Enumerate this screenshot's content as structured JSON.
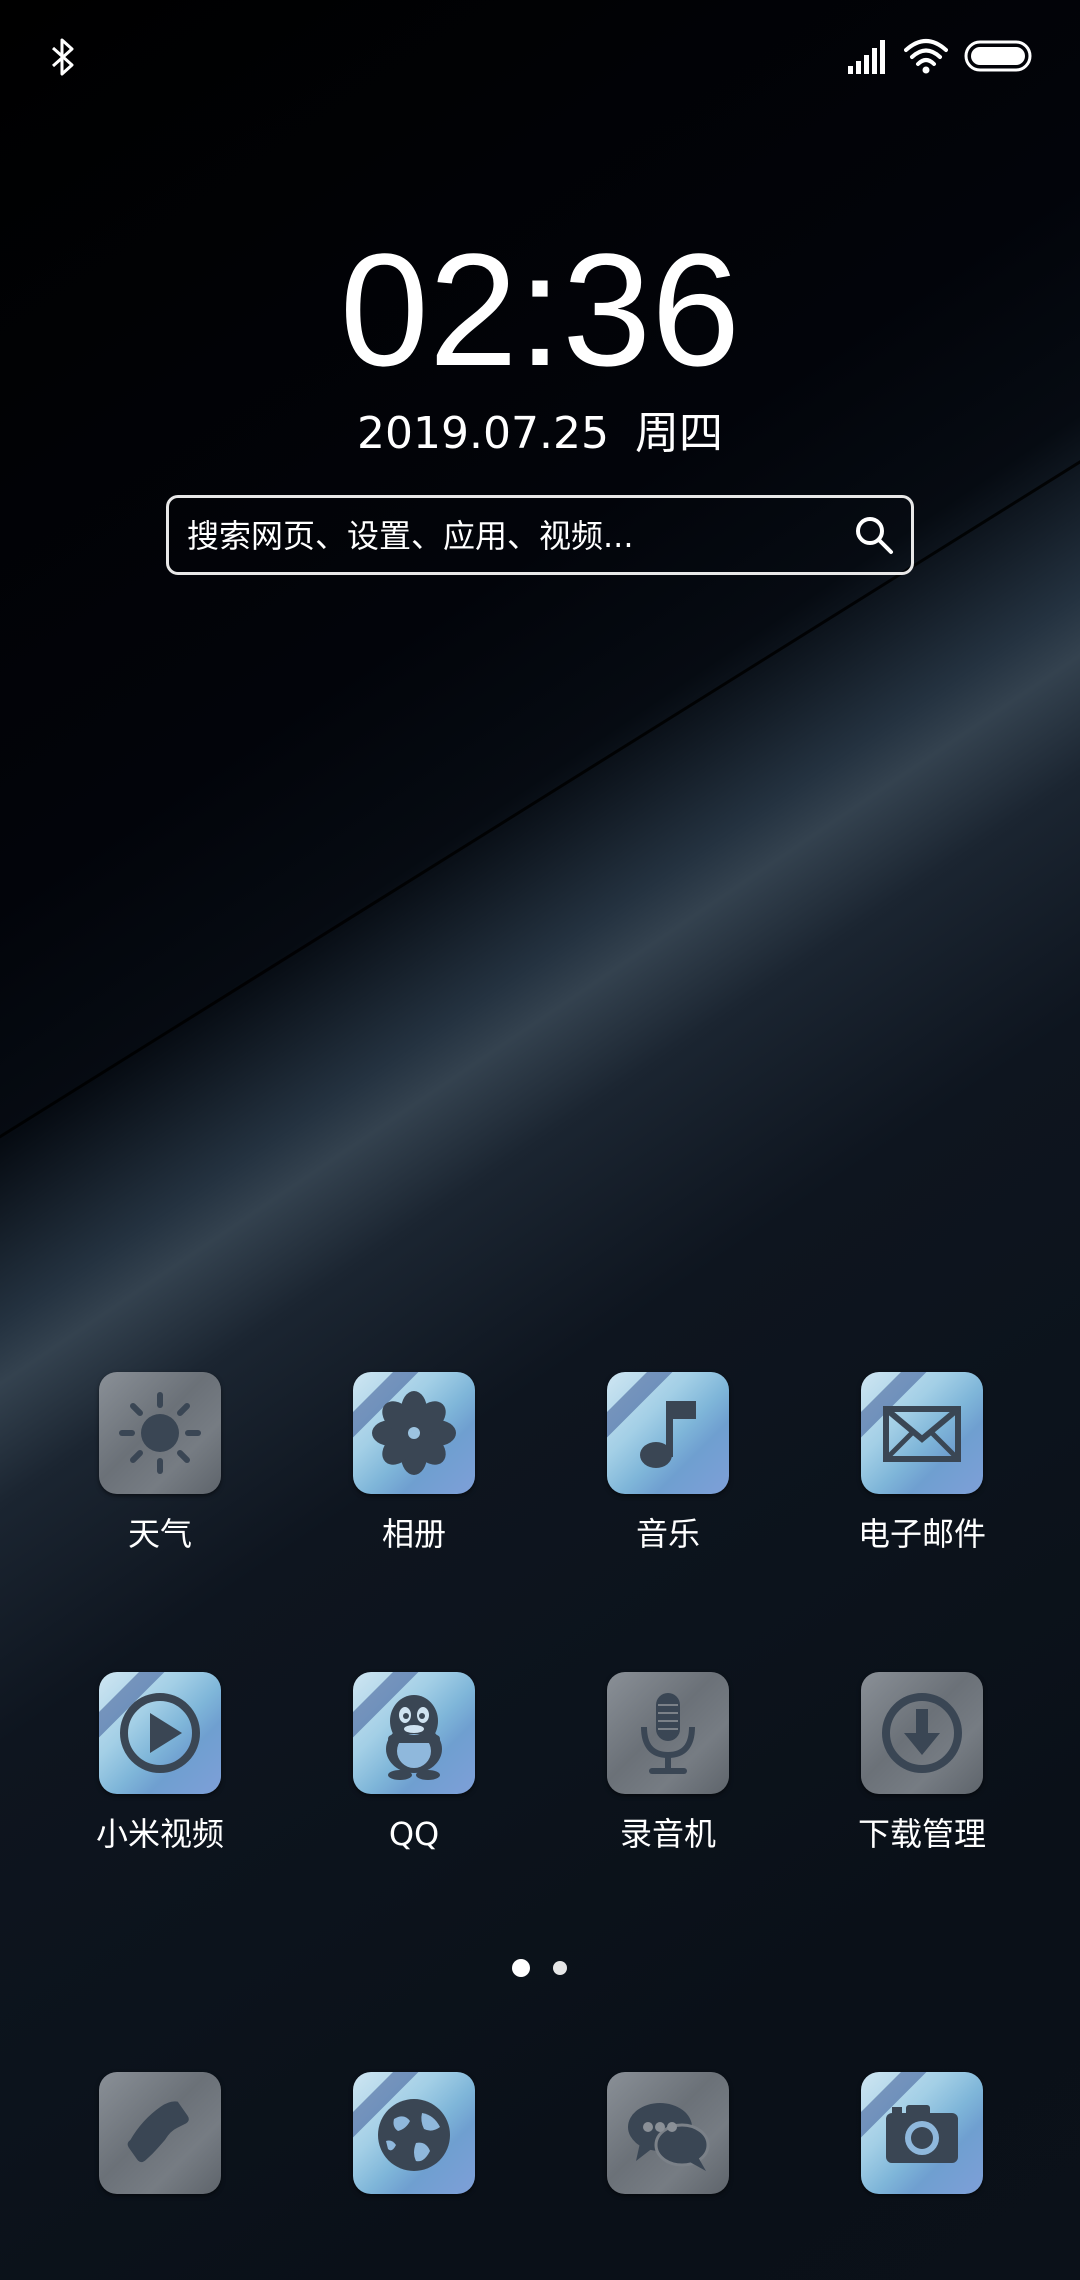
{
  "status_bar": {
    "left_icons": [
      "bluetooth-icon"
    ],
    "right_icons": [
      "signal-icon",
      "wifi-icon",
      "battery-icon"
    ]
  },
  "clock": {
    "time": "02:36",
    "date": "2019.07.25",
    "weekday": "周四"
  },
  "search": {
    "placeholder": "搜索网页、设置、应用、视频..."
  },
  "apps": [
    {
      "label": "天气",
      "icon": "sun-icon",
      "style": "gray"
    },
    {
      "label": "相册",
      "icon": "flower-icon",
      "style": "blue"
    },
    {
      "label": "音乐",
      "icon": "music-note-icon",
      "style": "blue"
    },
    {
      "label": "电子邮件",
      "icon": "envelope-icon",
      "style": "blue"
    },
    {
      "label": "小米视频",
      "icon": "play-icon",
      "style": "blue"
    },
    {
      "label": "QQ",
      "icon": "penguin-icon",
      "style": "blue"
    },
    {
      "label": "录音机",
      "icon": "microphone-icon",
      "style": "gray"
    },
    {
      "label": "下载管理",
      "icon": "download-icon",
      "style": "gray"
    }
  ],
  "pager": {
    "pages": 2,
    "current": 1
  },
  "dock": [
    {
      "icon": "phone-icon",
      "style": "gray"
    },
    {
      "icon": "globe-icon",
      "style": "blue"
    },
    {
      "icon": "chat-bubbles-icon",
      "style": "gray"
    },
    {
      "icon": "camera-icon",
      "style": "blue"
    }
  ],
  "colors": {
    "icon_glyph": "#3a4654",
    "text": "#ffffff"
  }
}
